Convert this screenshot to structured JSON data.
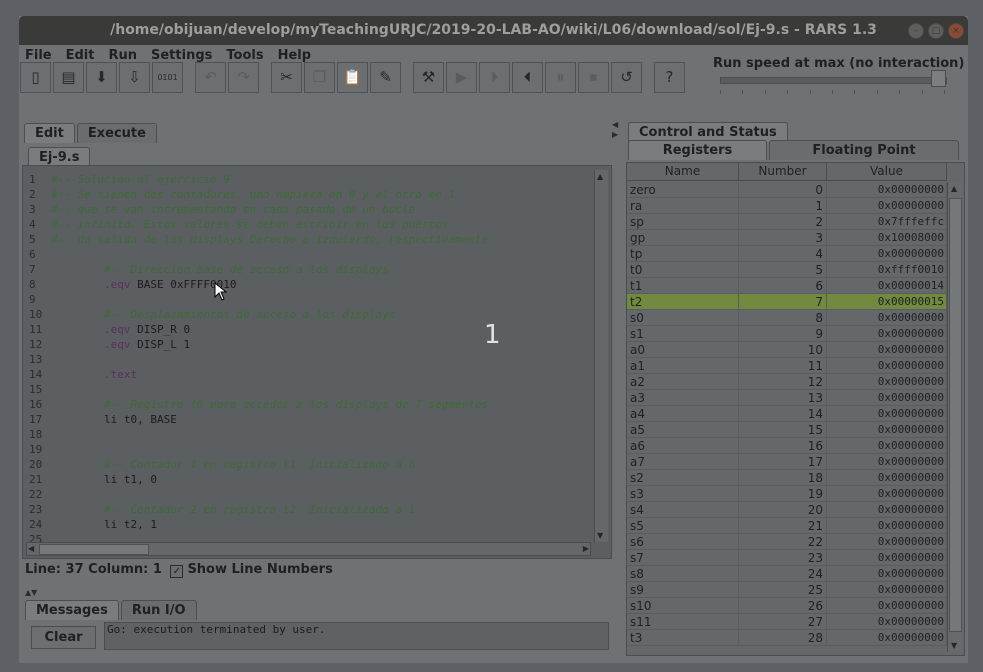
{
  "window": {
    "title": "/home/obijuan/develop/myTeachingURJC/2019-20-LAB-AO/wiki/L06/download/sol/Ej-9.s  - RARS 1.3"
  },
  "menu": [
    "File",
    "Edit",
    "Run",
    "Settings",
    "Tools",
    "Help"
  ],
  "toolbar": {
    "buttons": [
      {
        "icon": "new-file-icon",
        "glyph": "▯",
        "enabled": true
      },
      {
        "icon": "open-file-icon",
        "glyph": "▤",
        "enabled": true
      },
      {
        "icon": "save-file-icon",
        "glyph": "⬇",
        "enabled": true
      },
      {
        "icon": "save-as-icon",
        "glyph": "⇩",
        "enabled": true
      },
      {
        "icon": "dump-memory-icon",
        "glyph": "0101",
        "enabled": true
      },
      {
        "icon": "undo-icon",
        "glyph": "↶",
        "enabled": false
      },
      {
        "icon": "redo-icon",
        "glyph": "↷",
        "enabled": false
      },
      {
        "icon": "cut-icon",
        "glyph": "✂",
        "enabled": true
      },
      {
        "icon": "copy-icon",
        "glyph": "❐",
        "enabled": false
      },
      {
        "icon": "paste-icon",
        "glyph": "📋",
        "enabled": true
      },
      {
        "icon": "find-replace-icon",
        "glyph": "✎",
        "enabled": true
      },
      {
        "icon": "assemble-icon",
        "glyph": "⚒",
        "enabled": true
      },
      {
        "icon": "run-icon",
        "glyph": "▶",
        "enabled": false
      },
      {
        "icon": "step-icon",
        "glyph": "⏵",
        "enabled": false
      },
      {
        "icon": "backstep-icon",
        "glyph": "⏴",
        "enabled": true
      },
      {
        "icon": "pause-icon",
        "glyph": "⏸",
        "enabled": false
      },
      {
        "icon": "stop-icon",
        "glyph": "⏹",
        "enabled": false
      },
      {
        "icon": "reset-icon",
        "glyph": "↺",
        "enabled": true
      },
      {
        "icon": "help-icon",
        "glyph": "?",
        "enabled": true
      }
    ],
    "run_speed_label": "Run speed at max (no interaction)",
    "run_speed_fraction": 1.0
  },
  "left_tabs": [
    "Edit",
    "Execute"
  ],
  "file_tab": "Ej-9.s",
  "editor": {
    "lines": [
      {
        "n": "1",
        "text": "#-- Solucion al ejercicio 9",
        "kind": "comment"
      },
      {
        "n": "2",
        "text": "#-- Se tienen dos contadores, uno empieza en 0 y el otro en 1",
        "kind": "comment"
      },
      {
        "n": "3",
        "text": "#-- que se van incrementando en cada pasada de un bucle",
        "kind": "comment"
      },
      {
        "n": "4",
        "text": "#-- infinito. Estos valores se deben escribir en los puertos",
        "kind": "comment"
      },
      {
        "n": "5",
        "text": "#-- de salida de los displays Derecho e izquierdo, respectivamente",
        "kind": "comment"
      },
      {
        "n": "6",
        "text": "",
        "kind": "code"
      },
      {
        "n": "7",
        "text": "        #-- Direccion base de acceso a los displays",
        "kind": "comment"
      },
      {
        "n": "8",
        "text": "        .eqv BASE 0xFFFF0010",
        "kind": "eqv"
      },
      {
        "n": "9",
        "text": "",
        "kind": "code"
      },
      {
        "n": "10",
        "text": "        #-- Desplazamientos de acceso a los displays",
        "kind": "comment"
      },
      {
        "n": "11",
        "text": "        .eqv DISP_R 0",
        "kind": "eqv"
      },
      {
        "n": "12",
        "text": "        .eqv DISP_L 1",
        "kind": "eqv"
      },
      {
        "n": "13",
        "text": "",
        "kind": "code"
      },
      {
        "n": "14",
        "text": "        .text",
        "kind": "directive"
      },
      {
        "n": "15",
        "text": "",
        "kind": "code"
      },
      {
        "n": "16",
        "text": "        #-- Registro t0 para acceder a los displays de 7 segmentos",
        "kind": "comment"
      },
      {
        "n": "17",
        "text": "        li t0, BASE",
        "kind": "code"
      },
      {
        "n": "18",
        "text": "",
        "kind": "code"
      },
      {
        "n": "19",
        "text": "",
        "kind": "code"
      },
      {
        "n": "20",
        "text": "        #-- Contador 1 en registro t1. Inicializado a 0",
        "kind": "comment"
      },
      {
        "n": "21",
        "text": "        li t1, 0",
        "kind": "code"
      },
      {
        "n": "22",
        "text": "",
        "kind": "code"
      },
      {
        "n": "23",
        "text": "        #-- Contador 2 en registro t2. Inicializado a 1",
        "kind": "comment"
      },
      {
        "n": "24",
        "text": "        li t2, 1",
        "kind": "code"
      },
      {
        "n": "25",
        "text": "",
        "kind": "code"
      }
    ],
    "overlay_number": "1"
  },
  "status": {
    "position": "Line: 37 Column: 1",
    "show_line_numbers_label": "Show Line Numbers",
    "show_line_numbers_checked": true
  },
  "messages": {
    "tabs": [
      "Messages",
      "Run I/O"
    ],
    "clear_label": "Clear",
    "text": "Go: execution terminated by user."
  },
  "right_tabs": [
    "Control and Status"
  ],
  "register_tabs": [
    "Registers",
    "Floating Point"
  ],
  "registers": {
    "headers": [
      "Name",
      "Number",
      "Value"
    ],
    "highlight": "t2",
    "rows": [
      [
        "zero",
        "0",
        "0x00000000"
      ],
      [
        "ra",
        "1",
        "0x00000000"
      ],
      [
        "sp",
        "2",
        "0x7fffeffc"
      ],
      [
        "gp",
        "3",
        "0x10008000"
      ],
      [
        "tp",
        "4",
        "0x00000000"
      ],
      [
        "t0",
        "5",
        "0xffff0010"
      ],
      [
        "t1",
        "6",
        "0x00000014"
      ],
      [
        "t2",
        "7",
        "0x00000015"
      ],
      [
        "s0",
        "8",
        "0x00000000"
      ],
      [
        "s1",
        "9",
        "0x00000000"
      ],
      [
        "a0",
        "10",
        "0x00000000"
      ],
      [
        "a1",
        "11",
        "0x00000000"
      ],
      [
        "a2",
        "12",
        "0x00000000"
      ],
      [
        "a3",
        "13",
        "0x00000000"
      ],
      [
        "a4",
        "14",
        "0x00000000"
      ],
      [
        "a5",
        "15",
        "0x00000000"
      ],
      [
        "a6",
        "16",
        "0x00000000"
      ],
      [
        "a7",
        "17",
        "0x00000000"
      ],
      [
        "s2",
        "18",
        "0x00000000"
      ],
      [
        "s3",
        "19",
        "0x00000000"
      ],
      [
        "s4",
        "20",
        "0x00000000"
      ],
      [
        "s5",
        "21",
        "0x00000000"
      ],
      [
        "s6",
        "22",
        "0x00000000"
      ],
      [
        "s7",
        "23",
        "0x00000000"
      ],
      [
        "s8",
        "24",
        "0x00000000"
      ],
      [
        "s9",
        "25",
        "0x00000000"
      ],
      [
        "s10",
        "26",
        "0x00000000"
      ],
      [
        "s11",
        "27",
        "0x00000000"
      ],
      [
        "t3",
        "28",
        "0x00000000"
      ]
    ]
  },
  "colors": {
    "comment": "#3c6a38",
    "directive": "#5a2e62",
    "highlight_row": "#718a3f"
  }
}
